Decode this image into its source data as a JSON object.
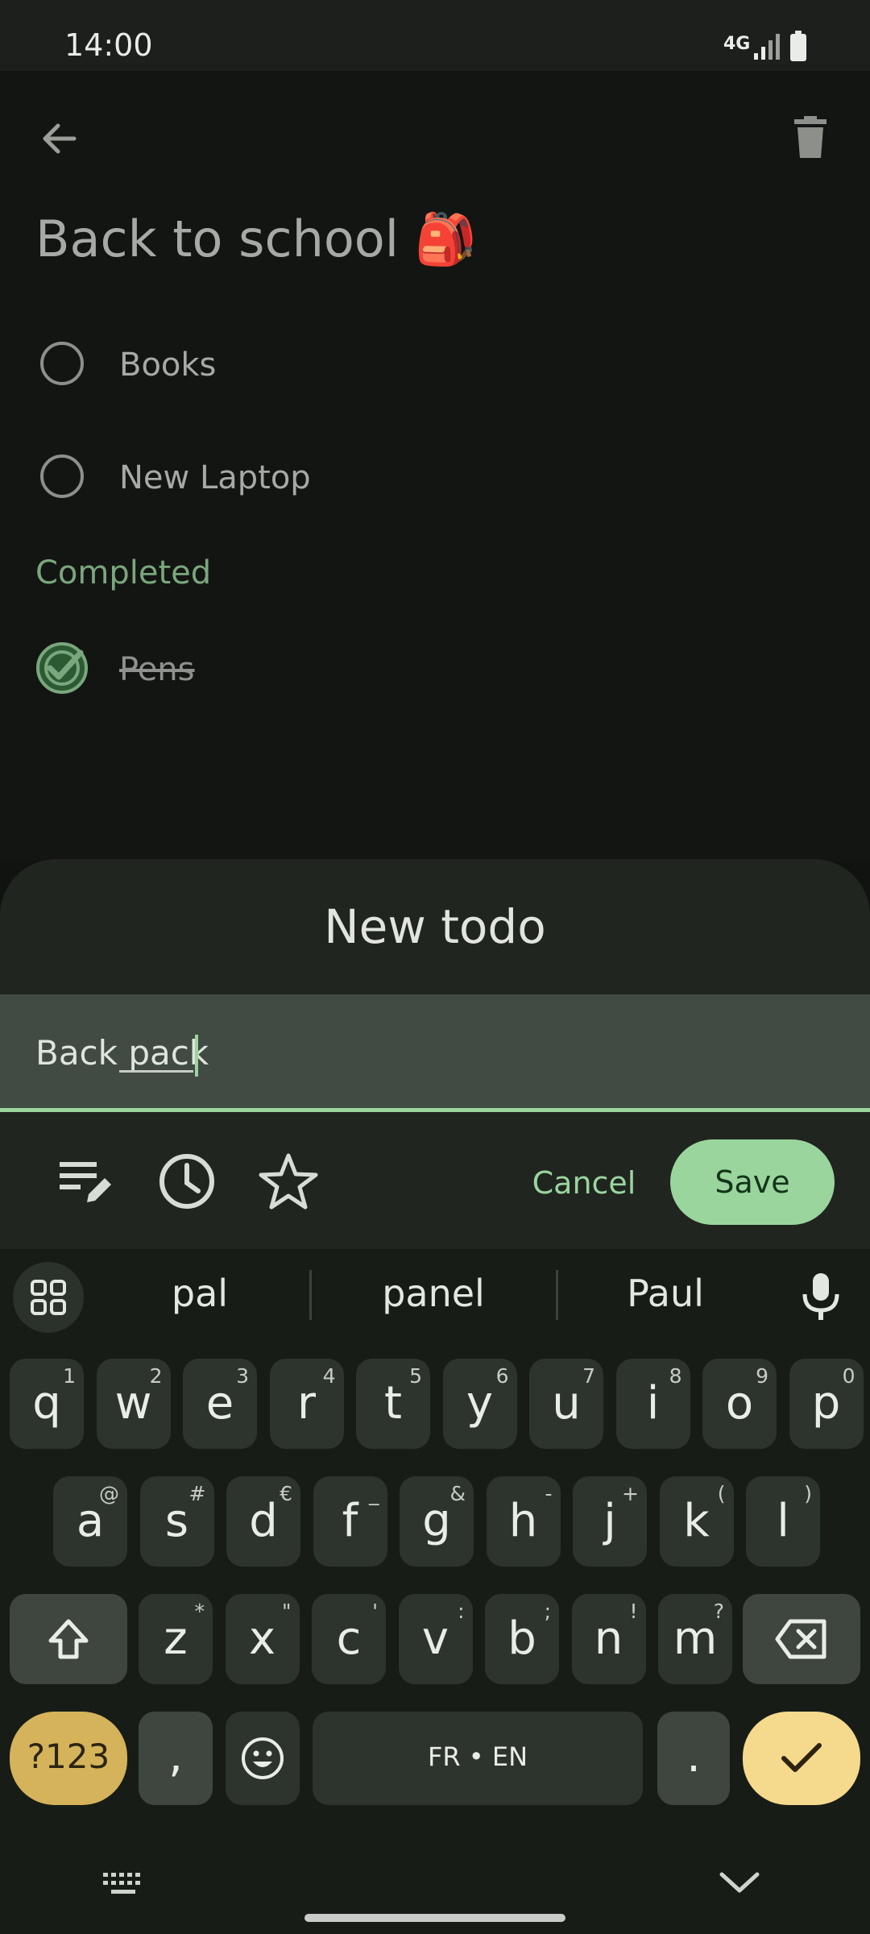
{
  "status_bar": {
    "time": "14:00",
    "network": "4G"
  },
  "app": {
    "list_title": "Back to school",
    "title_emoji": "🎒",
    "todos": [
      {
        "label": "Books"
      },
      {
        "label": "New Laptop"
      }
    ],
    "completed_header": "Completed",
    "completed_todos": [
      {
        "label": "Pens"
      }
    ]
  },
  "sheet": {
    "title": "New todo",
    "input_value": "Back pack",
    "cancel_label": "Cancel",
    "save_label": "Save",
    "tools": [
      "notes-edit-icon",
      "clock-icon",
      "star-icon"
    ]
  },
  "keyboard": {
    "suggestions": [
      "pal",
      "panel",
      "Paul"
    ],
    "row1": [
      {
        "k": "q",
        "h": "1"
      },
      {
        "k": "w",
        "h": "2"
      },
      {
        "k": "e",
        "h": "3"
      },
      {
        "k": "r",
        "h": "4"
      },
      {
        "k": "t",
        "h": "5"
      },
      {
        "k": "y",
        "h": "6"
      },
      {
        "k": "u",
        "h": "7"
      },
      {
        "k": "i",
        "h": "8"
      },
      {
        "k": "o",
        "h": "9"
      },
      {
        "k": "p",
        "h": "0"
      }
    ],
    "row2": [
      {
        "k": "a",
        "h": "@"
      },
      {
        "k": "s",
        "h": "#"
      },
      {
        "k": "d",
        "h": "€"
      },
      {
        "k": "f",
        "h": "_"
      },
      {
        "k": "g",
        "h": "&"
      },
      {
        "k": "h",
        "h": "-"
      },
      {
        "k": "j",
        "h": "+"
      },
      {
        "k": "k",
        "h": "("
      },
      {
        "k": "l",
        "h": ")"
      }
    ],
    "row3": [
      {
        "k": "z",
        "h": "*"
      },
      {
        "k": "x",
        "h": "\""
      },
      {
        "k": "c",
        "h": "'"
      },
      {
        "k": "v",
        "h": ":"
      },
      {
        "k": "b",
        "h": ";"
      },
      {
        "k": "n",
        "h": "!"
      },
      {
        "k": "m",
        "h": "?"
      }
    ],
    "symbols_label": "?123",
    "comma": ",",
    "space_label": "FR • EN",
    "period": "."
  },
  "colors": {
    "accent": "#9ad59e",
    "enter_key": "#f5d98c",
    "symbols_key": "#d4b35a",
    "background": "#131513"
  }
}
